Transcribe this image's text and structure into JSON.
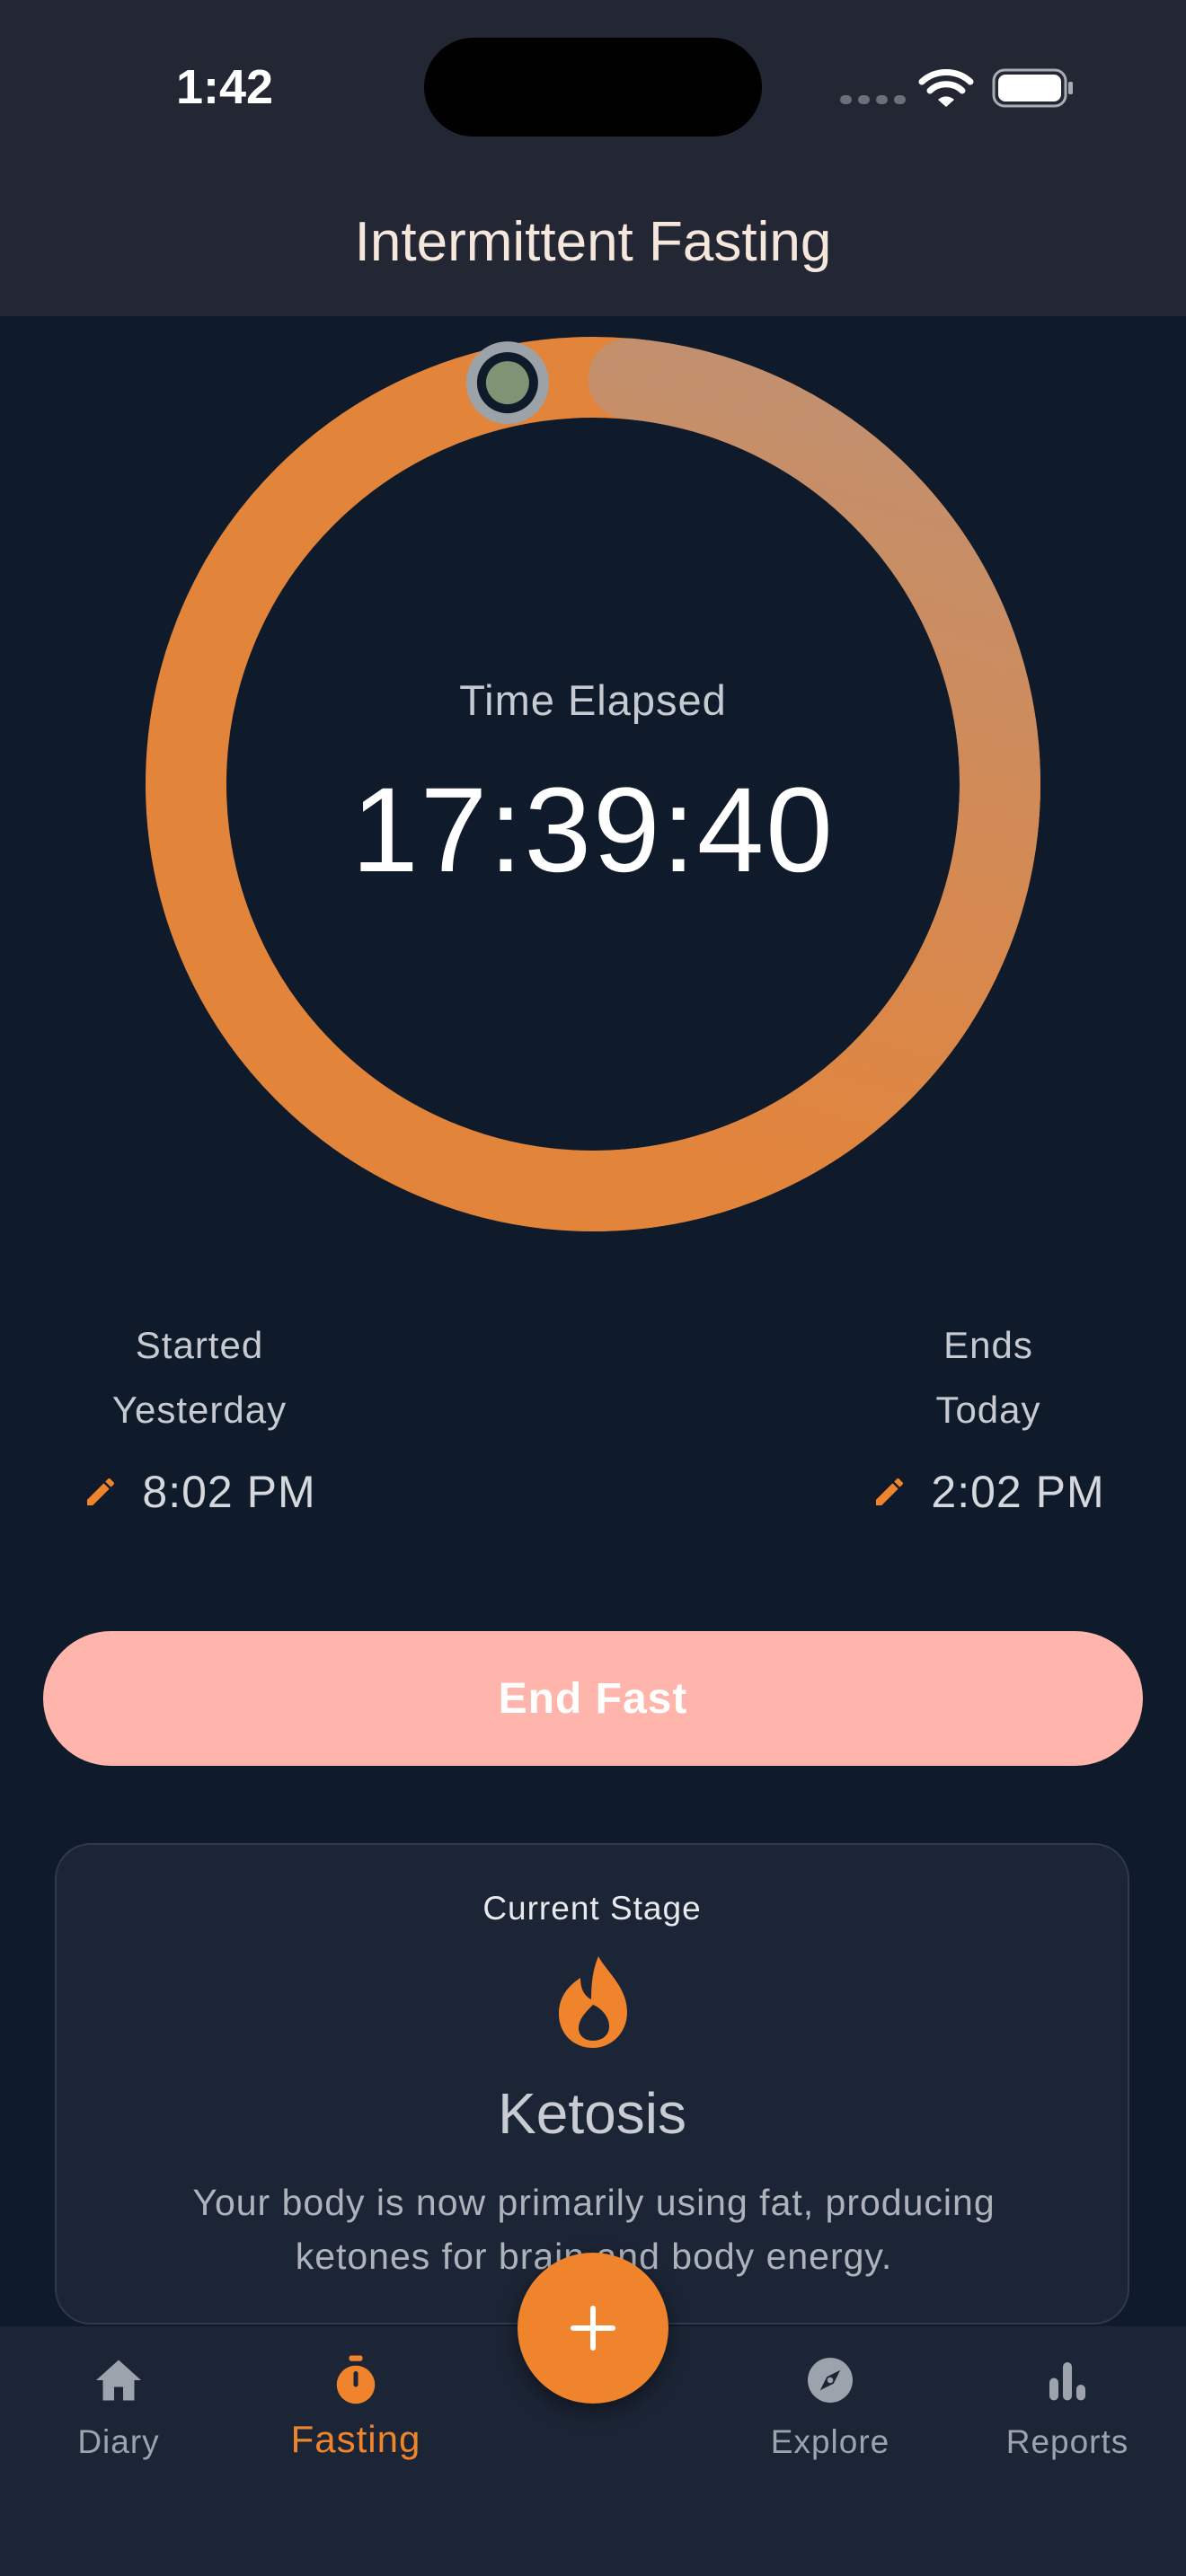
{
  "status_bar": {
    "time": "1:42"
  },
  "header": {
    "title": "Intermittent Fasting"
  },
  "timer": {
    "label": "Time Elapsed",
    "value": "17:39:40",
    "progress": 0.97
  },
  "start": {
    "label": "Started",
    "day": "Yesterday",
    "time": "8:02 PM"
  },
  "end": {
    "label": "Ends",
    "day": "Today",
    "time": "2:02 PM"
  },
  "end_button": {
    "label": "End Fast"
  },
  "stage": {
    "label": "Current Stage",
    "name": "Ketosis",
    "description": "Your body is now primarily using fat, producing ketones for brain and body energy."
  },
  "tabs": [
    {
      "label": "Diary",
      "icon": "home-icon"
    },
    {
      "label": "Fasting",
      "icon": "stopwatch-icon"
    },
    {
      "label": "Explore",
      "icon": "compass-icon"
    },
    {
      "label": "Reports",
      "icon": "bar-chart-icon"
    }
  ],
  "colors": {
    "accent": "#f0842c",
    "ring_start": "#e3843b",
    "ring_end": "#c2906f",
    "end_button_bg": "#ffb5ac",
    "background": "#0f1a2a",
    "card_bg": "#1c2536"
  }
}
